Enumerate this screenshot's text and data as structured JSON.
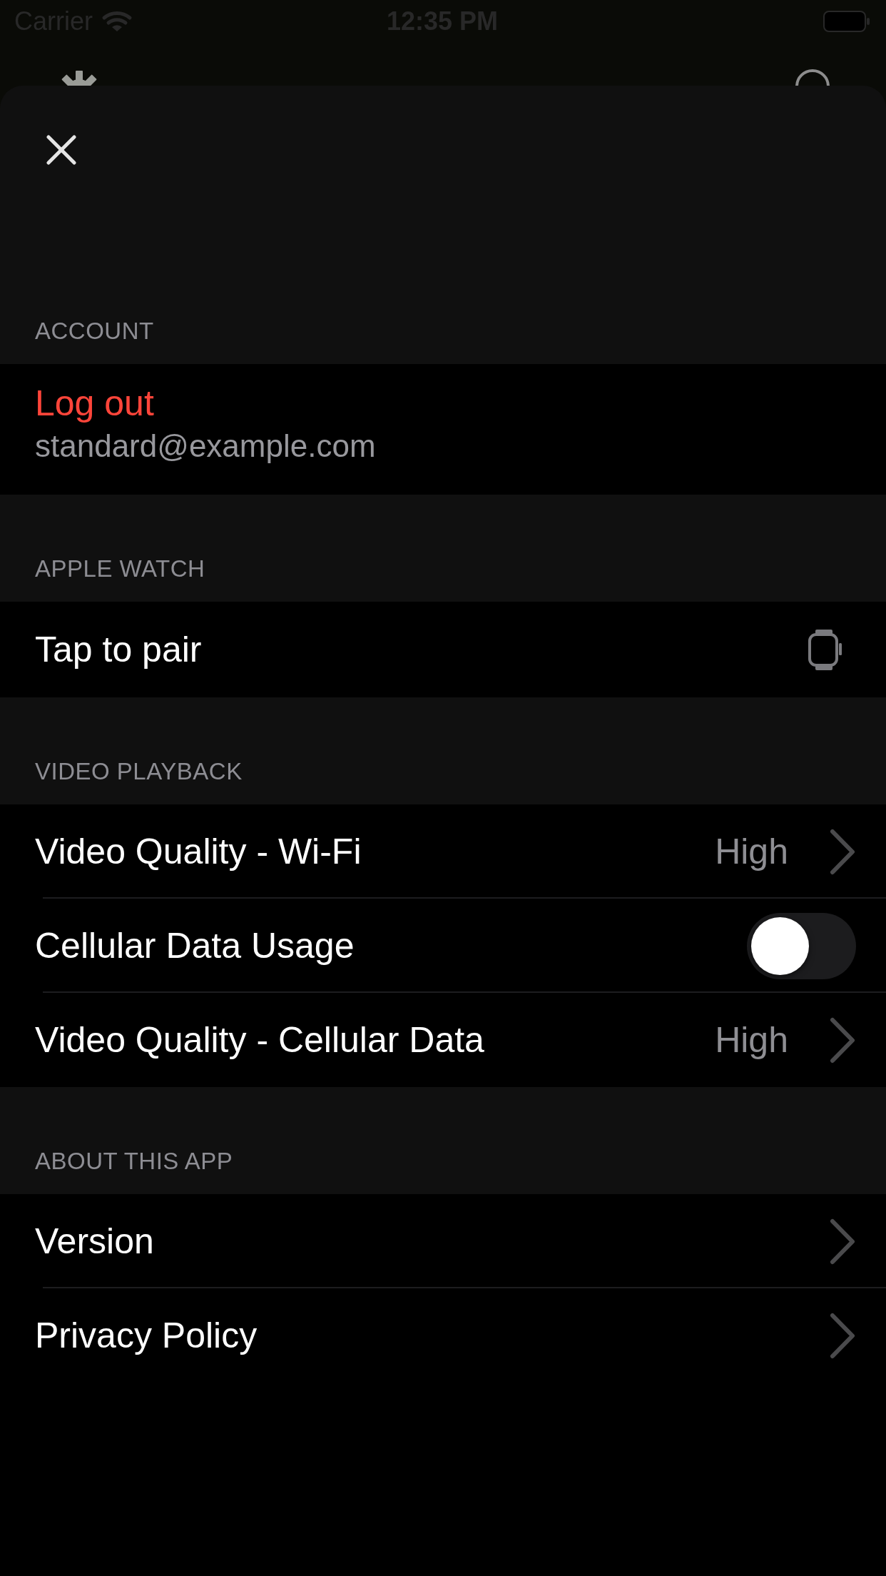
{
  "status_bar": {
    "carrier": "Carrier",
    "time": "12:35 PM"
  },
  "sections": [
    {
      "header": "ACCOUNT",
      "rows": [
        {
          "kind": "account",
          "title": "Log out",
          "subtitle": "standard@example.com"
        }
      ]
    },
    {
      "header": "APPLE WATCH",
      "rows": [
        {
          "kind": "watch",
          "title": "Tap to pair"
        }
      ]
    },
    {
      "header": "VIDEO PLAYBACK",
      "rows": [
        {
          "kind": "disclosure",
          "title": "Video Quality - Wi-Fi",
          "value": "High"
        },
        {
          "kind": "toggle",
          "title": "Cellular Data Usage",
          "on": false
        },
        {
          "kind": "disclosure",
          "title": "Video Quality - Cellular Data",
          "value": "High"
        }
      ]
    },
    {
      "header": "ABOUT THIS APP",
      "rows": [
        {
          "kind": "disclosure",
          "title": "Version"
        },
        {
          "kind": "disclosure",
          "title": "Privacy Policy"
        }
      ]
    }
  ]
}
